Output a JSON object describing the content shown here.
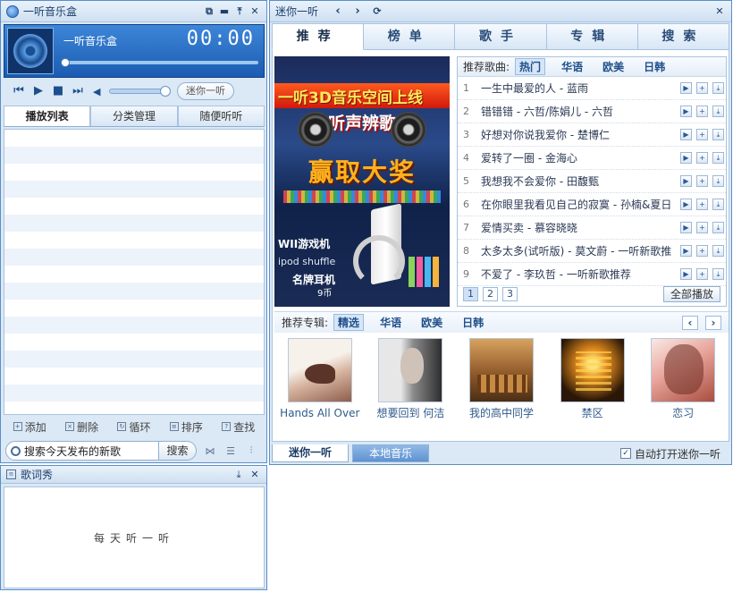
{
  "player": {
    "title": "一听音乐盒",
    "now_playing": {
      "title": "一听音乐盒",
      "time": "00:00",
      "progress": 0
    },
    "mini_button": "迷你一听",
    "tabs": [
      {
        "label": "播放列表",
        "active": true
      },
      {
        "label": "分类管理",
        "active": false
      },
      {
        "label": "随便听听",
        "active": false
      }
    ],
    "toolbar": {
      "add": "添加",
      "delete": "删除",
      "loop": "循环",
      "sort": "排序",
      "find": "查找"
    },
    "search": {
      "value": "搜索今天发布的新歌",
      "button": "搜索"
    }
  },
  "lyrics": {
    "title": "歌词秀",
    "text": "每天听一听"
  },
  "mini": {
    "title": "迷你一听",
    "tabs": [
      {
        "label": "推荐",
        "active": true
      },
      {
        "label": "榜单",
        "active": false
      },
      {
        "label": "歌手",
        "active": false
      },
      {
        "label": "专辑",
        "active": false
      },
      {
        "label": "搜索",
        "active": false
      }
    ],
    "banner": {
      "line1": "一听3D音乐空间上线",
      "line2": "听声辨歌",
      "prize": "赢取大奖",
      "item1": "WII游戏机",
      "item2": "ipod shuffle",
      "item3": "名牌耳机",
      "price": "9币"
    },
    "songs": {
      "label": "推荐歌曲:",
      "categories": [
        {
          "label": "热门",
          "active": true
        },
        {
          "label": "华语",
          "active": false
        },
        {
          "label": "欧美",
          "active": false
        },
        {
          "label": "日韩",
          "active": false
        }
      ],
      "items": [
        {
          "num": "1",
          "title": "一生中最爱的人 - 蓝雨"
        },
        {
          "num": "2",
          "title": "错错错 - 六哲/陈娟儿 - 六哲"
        },
        {
          "num": "3",
          "title": "好想对你说我爱你 - 楚博仁"
        },
        {
          "num": "4",
          "title": "爱转了一圈 - 金海心"
        },
        {
          "num": "5",
          "title": "我想我不会爱你 - 田馥甄"
        },
        {
          "num": "6",
          "title": "在你眼里我看见自己的寂寞 - 孙楠&夏日"
        },
        {
          "num": "7",
          "title": "爱情买卖 - 慕容晓晓"
        },
        {
          "num": "8",
          "title": "太多太多(试听版) - 莫文蔚 - 一听新歌推"
        },
        {
          "num": "9",
          "title": "不爱了 - 李玖哲 - 一听新歌推荐"
        }
      ],
      "pages": [
        "1",
        "2",
        "3"
      ],
      "play_all": "全部播放"
    },
    "albums": {
      "label": "推荐专辑:",
      "categories": [
        {
          "label": "精选",
          "active": true
        },
        {
          "label": "华语",
          "active": false
        },
        {
          "label": "欧美",
          "active": false
        },
        {
          "label": "日韩",
          "active": false
        }
      ],
      "items": [
        {
          "name": "Hands All Over"
        },
        {
          "name": "想要回到 何洁"
        },
        {
          "name": "我的高中同学"
        },
        {
          "name": "禁区"
        },
        {
          "name": "恋习"
        }
      ]
    },
    "bottom_tabs": [
      {
        "label": "迷你一听",
        "active": true
      },
      {
        "label": "本地音乐",
        "active": false
      }
    ],
    "auto_open": {
      "label": "自动打开迷你一听",
      "checked": true
    }
  }
}
